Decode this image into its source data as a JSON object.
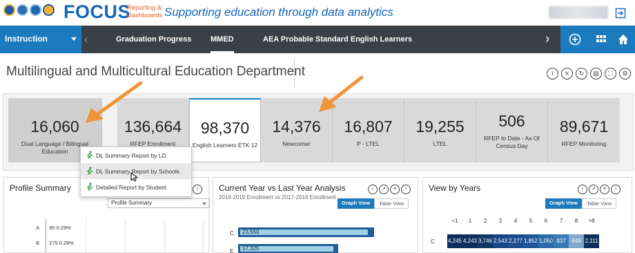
{
  "header": {
    "brand": "FOCUS",
    "brand_sub": "Reporting & Dashboards",
    "tagline": "Supporting education through data analytics"
  },
  "nav": {
    "select_label": "Instruction",
    "tabs": [
      {
        "label": "Graduation Progress",
        "active": false
      },
      {
        "label": "MMED",
        "active": true
      },
      {
        "label": "AEA Probable Standard English Learners",
        "active": false
      }
    ]
  },
  "page": {
    "title": "Multilingual and Multicultural Education Department"
  },
  "kpis": [
    {
      "value": "16,060",
      "label": "Dual Language / Bilingual Education"
    },
    {
      "value": "136,664",
      "label": "RFEP Enrollment"
    },
    {
      "value": "98,370",
      "label": "English Learners ETK 12"
    },
    {
      "value": "14,376",
      "label": "Newcomer"
    },
    {
      "value": "16,807",
      "label": "P - LTEL"
    },
    {
      "value": "19,255",
      "label": "LTEL"
    },
    {
      "value": "506",
      "label": "RFEP to Date - As Of Census Day"
    },
    {
      "value": "89,671",
      "label": "RFEP Monitoring"
    }
  ],
  "menu": {
    "items": [
      {
        "label": "DL Summary Report by LD"
      },
      {
        "label": "DL Summary Report by Schools"
      },
      {
        "label": "Detailed Report by Student"
      }
    ]
  },
  "panels": {
    "profile": {
      "title": "Profile Summary",
      "select_value": "Profile Summary",
      "rows": [
        {
          "cat": "A",
          "count": "95",
          "pct": "0.29%"
        },
        {
          "cat": "B",
          "count": "275",
          "pct": "0.29%"
        }
      ]
    },
    "current": {
      "title": "Current Year vs Last Year Analysis",
      "subtitle": "2018-2019 Enrollment vs 2017-2018 Enrollment",
      "graph_view": "Graph View",
      "table_view": "Table View",
      "bars": [
        {
          "cat": "C",
          "label": "23,550"
        },
        {
          "cat": "E",
          "label": "17,325"
        }
      ]
    },
    "years": {
      "title": "View by Years",
      "graph_view": "Graph View",
      "table_view": "Table View",
      "columns": [
        "<1",
        "1",
        "2",
        "3",
        "4",
        "5",
        "6",
        "7",
        "8",
        ">8"
      ],
      "row_label": "C",
      "cells": [
        "4,245",
        "4,243",
        "3,746",
        "2,543",
        "2,277",
        "1,852",
        "1,050",
        "837",
        "646",
        "2,111"
      ]
    }
  },
  "colors": {
    "accent": "#1c7bbf",
    "nav_bg": "#3a4047",
    "arrow": "#f0943a"
  }
}
